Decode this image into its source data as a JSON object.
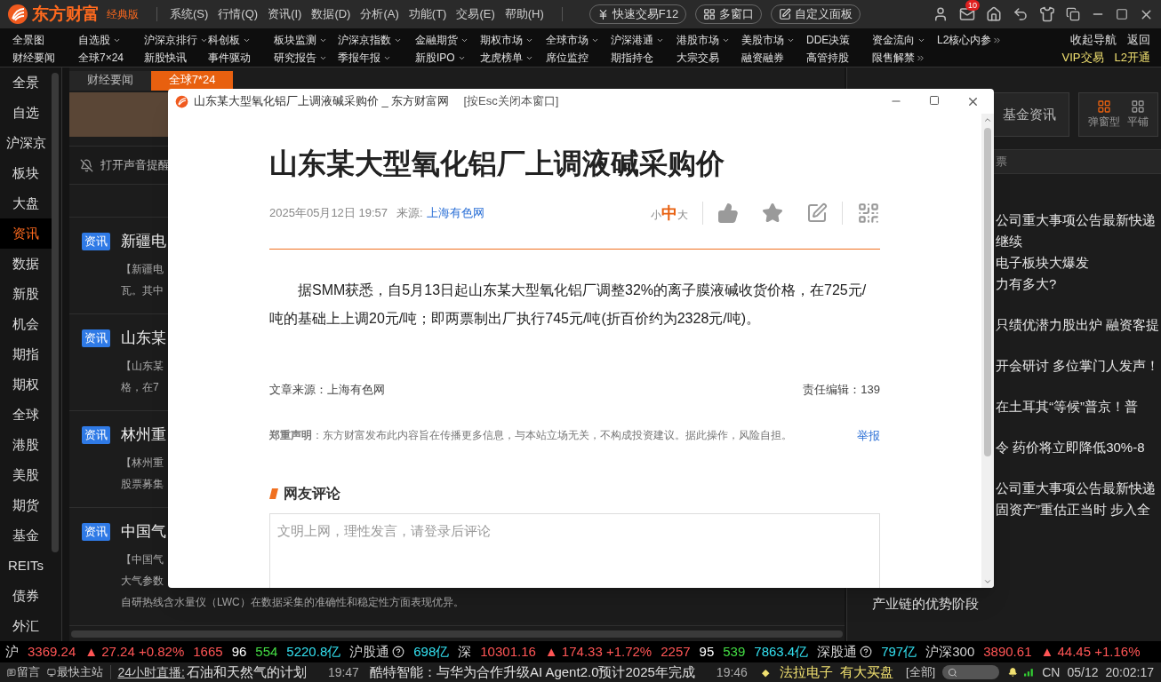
{
  "title_bar": {
    "app_name": "东方财富",
    "edition": "经典版",
    "menus": [
      "系统(S)",
      "行情(Q)",
      "资讯(I)",
      "数据(D)",
      "分析(A)",
      "功能(T)",
      "交易(E)",
      "帮助(H)"
    ],
    "pills": [
      {
        "label": "快速交易F12",
        "kind": "trade"
      },
      {
        "label": "多窗口",
        "kind": "grid"
      },
      {
        "label": "自定义面板",
        "kind": "custom"
      }
    ],
    "mail_badge": "10"
  },
  "nav": {
    "rows": [
      [
        {
          "label": "全景图",
          "dropdown": false,
          "more": false
        },
        {
          "label": "自选股",
          "dropdown": true,
          "more": false
        },
        {
          "label": "沪深京排行",
          "dropdown": true,
          "more": false
        },
        {
          "label": "科创板",
          "dropdown": true,
          "more": false
        },
        {
          "label": "板块监测",
          "dropdown": true,
          "more": false
        },
        {
          "label": "沪深京指数",
          "dropdown": true,
          "more": false
        },
        {
          "label": "金融期货",
          "dropdown": true,
          "more": false
        },
        {
          "label": "期权市场",
          "dropdown": true,
          "more": false
        },
        {
          "label": "全球市场",
          "dropdown": true,
          "more": false
        },
        {
          "label": "沪深港通",
          "dropdown": true,
          "more": false
        },
        {
          "label": "港股市场",
          "dropdown": true,
          "more": false
        },
        {
          "label": "美股市场",
          "dropdown": true,
          "more": false
        },
        {
          "label": "DDE决策",
          "dropdown": false,
          "more": false
        },
        {
          "label": "资金流向",
          "dropdown": true,
          "more": false
        },
        {
          "label": "L2核心内参",
          "dropdown": false,
          "more": true
        }
      ],
      [
        {
          "label": "财经要闻",
          "dropdown": false,
          "more": false
        },
        {
          "label": "全球7×24",
          "dropdown": false,
          "more": false
        },
        {
          "label": "新股快讯",
          "dropdown": false,
          "more": false
        },
        {
          "label": "事件驱动",
          "dropdown": false,
          "more": false
        },
        {
          "label": "研究报告",
          "dropdown": true,
          "more": false
        },
        {
          "label": "季报年报",
          "dropdown": true,
          "more": false
        },
        {
          "label": "新股IPO",
          "dropdown": true,
          "more": false
        },
        {
          "label": "龙虎榜单",
          "dropdown": true,
          "more": false
        },
        {
          "label": "席位监控",
          "dropdown": false,
          "more": false
        },
        {
          "label": "期指持仓",
          "dropdown": false,
          "more": false
        },
        {
          "label": "大宗交易",
          "dropdown": false,
          "more": false
        },
        {
          "label": "融资融券",
          "dropdown": false,
          "more": false
        },
        {
          "label": "高管持股",
          "dropdown": false,
          "more": false
        },
        {
          "label": "限售解禁",
          "dropdown": false,
          "more": true
        }
      ]
    ],
    "right_rows": [
      [
        {
          "label": "收起导航",
          "kind": "plain"
        },
        {
          "label": "返回",
          "kind": "plain"
        }
      ],
      [
        {
          "label": "VIP交易",
          "kind": "vip"
        },
        {
          "label": "L2开通",
          "kind": "vip"
        }
      ]
    ]
  },
  "sidebar": {
    "items": [
      {
        "label": "全景",
        "selected": false
      },
      {
        "label": "自选",
        "selected": false
      },
      {
        "label": "沪深京",
        "selected": false
      },
      {
        "label": "板块",
        "selected": false
      },
      {
        "label": "大盘",
        "selected": false
      },
      {
        "label": "资讯",
        "selected": true
      },
      {
        "label": "数据",
        "selected": false
      },
      {
        "label": "新股",
        "selected": false
      },
      {
        "label": "机会",
        "selected": false
      },
      {
        "label": "期指",
        "selected": false
      },
      {
        "label": "期权",
        "selected": false
      },
      {
        "label": "全球",
        "selected": false
      },
      {
        "label": "港股",
        "selected": false
      },
      {
        "label": "美股",
        "selected": false
      },
      {
        "label": "期货",
        "selected": false
      },
      {
        "label": "基金",
        "selected": false
      },
      {
        "label": "REITs",
        "selected": false
      },
      {
        "label": "债券",
        "selected": false
      },
      {
        "label": "外汇",
        "selected": false
      }
    ]
  },
  "news_panel": {
    "tabs": [
      {
        "label": "财经要闻",
        "selected": false
      },
      {
        "label": "全球7*24",
        "selected": true
      }
    ],
    "sound_toggle": "打开声音提醒",
    "items": [
      {
        "badge": "资讯",
        "title": "新疆电",
        "lines": [
          "【新疆电",
          "瓦。其中"
        ]
      },
      {
        "badge": "资讯",
        "title": "山东某",
        "lines": [
          "【山东某",
          "格，在7"
        ]
      },
      {
        "badge": "资讯",
        "title": "林州重",
        "lines": [
          "【林州重",
          "股票募集"
        ]
      },
      {
        "badge": "资讯",
        "title": "中国气",
        "lines": [
          "【中国气",
          "大气参数",
          "自研热线含水量仪（LWC）在数据采集的准确性和稳定性方面表现优异。"
        ]
      }
    ]
  },
  "right_panel": {
    "tab": "基金资讯",
    "views": [
      {
        "label": "弹窗型",
        "selected": true
      },
      {
        "label": "平铺",
        "selected": false
      }
    ],
    "header_fragment": "票",
    "groups": [
      [
        "公司重大事项公告最新快递",
        "继续",
        "电子板块大爆发",
        "力有多大?"
      ],
      [
        "只绩优潜力股出炉 融资客提"
      ],
      [
        "开会研讨 多位掌门人发声！"
      ],
      [
        "在土耳其“等候”普京！普"
      ],
      [
        "令 药价将立即降低30%-8"
      ],
      [
        "公司重大事项公告最新快递",
        "固资产”重估正当时 步入全"
      ]
    ],
    "last_line": "产业链的优势阶段"
  },
  "dialog": {
    "title": "山东某大型氧化铝厂上调液碱采购价 _ 东方财富网",
    "esc_hint": "[按Esc关闭本窗口]",
    "headline": "山东某大型氧化铝厂上调液碱采购价",
    "date": "2025年05月12日 19:57",
    "source_label": "来源:",
    "source": "上海有色网",
    "font_sizes": [
      {
        "label": "小",
        "selected": false
      },
      {
        "label": "中",
        "selected": true
      },
      {
        "label": "大",
        "selected": false
      }
    ],
    "body": "据SMM获悉，自5月13日起山东某大型氧化铝厂调整32%的离子膜液碱收货价格，在725元/吨的基础上上调20元/吨；即两票制出厂执行745元/吨(折百价约为2328元/吨)。",
    "article_source": "文章来源：上海有色网",
    "editor": "责任编辑：139",
    "disclaimer": "**郑重声明**：东方财富发布此内容旨在传播更多信息，与本站立场无关，不构成投资建议。据此操作，风险自担。",
    "report": "举报",
    "comments_title": "网友评论",
    "comment_placeholder": "文明上网，理性发言，请登录后评论"
  },
  "index_bar": {
    "segments": [
      {
        "text": "沪",
        "kind": "label"
      },
      {
        "text": "3369.24",
        "kind": "up"
      },
      {
        "text": "▲ 27.24 +0.82%",
        "kind": "up"
      },
      {
        "text": "1665",
        "kind": "up"
      },
      {
        "text": "96",
        "kind": "flat"
      },
      {
        "text": "554",
        "kind": "down"
      },
      {
        "text": "5220.8亿",
        "kind": "amount"
      },
      {
        "text": "沪股通",
        "kind": "connect"
      },
      {
        "text": "698亿",
        "kind": "amount"
      },
      {
        "text": "深",
        "kind": "label"
      },
      {
        "text": "10301.16",
        "kind": "up"
      },
      {
        "text": "▲ 174.33 +1.72%",
        "kind": "up"
      },
      {
        "text": "2257",
        "kind": "up"
      },
      {
        "text": "95",
        "kind": "flat"
      },
      {
        "text": "539",
        "kind": "down"
      },
      {
        "text": "7863.4亿",
        "kind": "amount"
      },
      {
        "text": "深股通",
        "kind": "connect"
      },
      {
        "text": "797亿",
        "kind": "amount"
      },
      {
        "text": "沪深300",
        "kind": "label"
      },
      {
        "text": "3890.61",
        "kind": "up"
      },
      {
        "text": "▲ 44.45 +1.16%",
        "kind": "up"
      }
    ]
  },
  "ticker": {
    "message": "留言",
    "fast_server": "最快主站",
    "live_label": "24小时直播:",
    "items": [
      {
        "text": "石油和天然气的计划",
        "time": "19:47"
      },
      {
        "text": "酷特智能：与华为合作升级AI Agent2.0预计2025年完成",
        "time": "19:46"
      }
    ],
    "alert_mark": "◆",
    "alert_stock": "法拉电子",
    "alert_text": "有大买盘",
    "all": "[全部]",
    "lang": "CN",
    "date": "05/12",
    "clock": "20:02:17"
  }
}
